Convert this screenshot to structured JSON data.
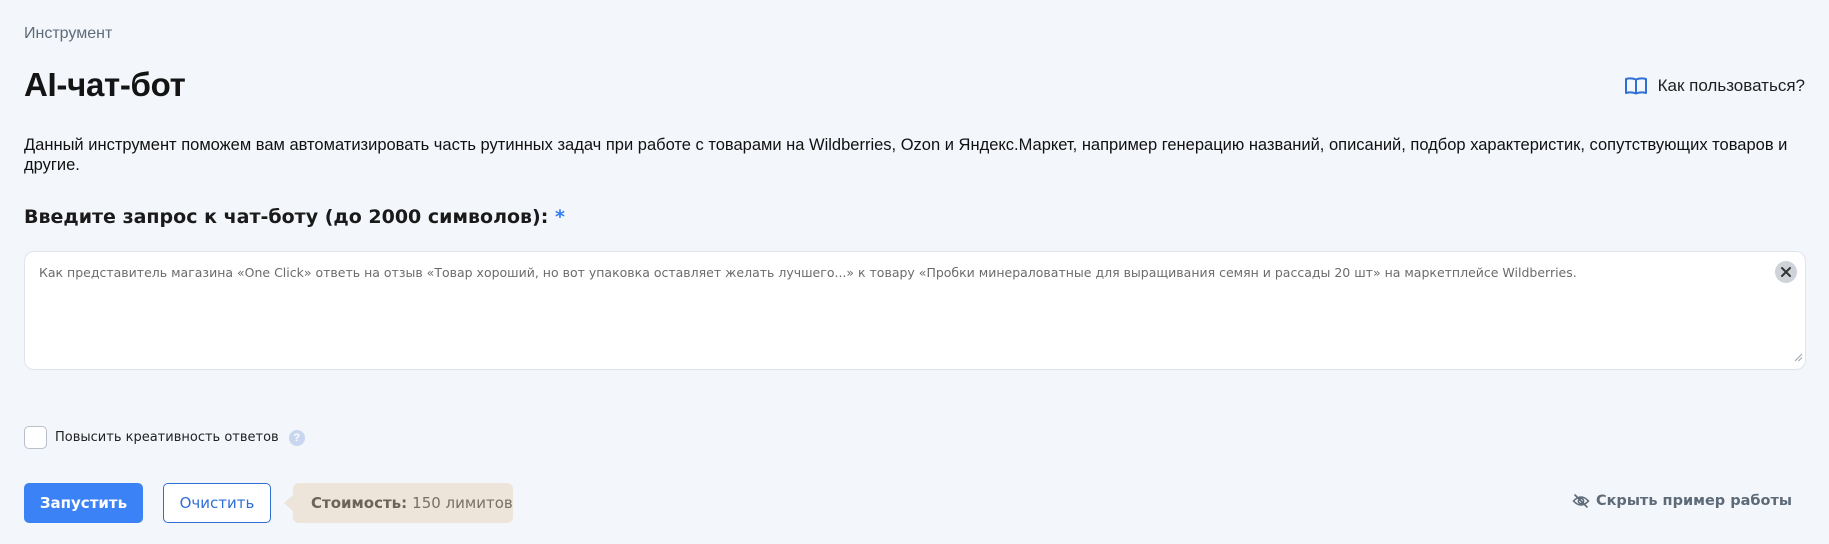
{
  "breadcrumb": "Инструмент",
  "title": "AI-чат-бот",
  "help": {
    "label": "Как пользоваться?",
    "icon": "book-icon"
  },
  "description": "Данный инструмент поможем вам автоматизировать часть рутинных задач при работе с товарами на Wildberries, Ozon и Яндекс.Маркет, например генерацию названий, описаний, подбор характеристик, сопутствующих товаров и другие.",
  "query": {
    "label": "Введите запрос к чат-боту (до 2000 символов):",
    "required_mark": "*",
    "value": "Как представитель магазина «One Click» ответь на отзыв «Товар хороший, но вот упаковка оставляет желать лучшего...» к товару «Пробки минераловатные для выращивания семян и рассады 20 шт» на маркетплейсе Wildberries."
  },
  "creativity": {
    "label": "Повысить креативность ответов",
    "checked": false,
    "help_glyph": "?"
  },
  "actions": {
    "run_label": "Запустить",
    "clear_label": "Очистить",
    "cost_label": "Стоимость:",
    "cost_value": "150 лимитов",
    "hide_example_label": "Скрыть пример работы"
  },
  "colors": {
    "accent": "#3b82f6",
    "background": "#f3f6fb",
    "cost_badge": "#ede4da"
  }
}
